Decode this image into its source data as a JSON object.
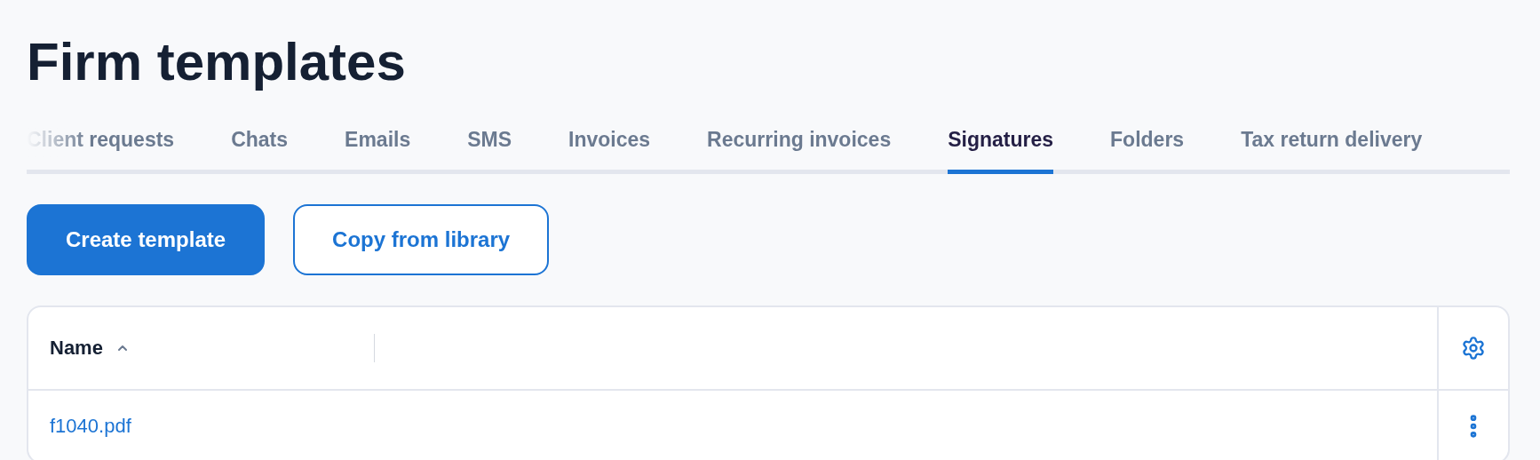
{
  "page_title": "Firm templates",
  "tabs": [
    {
      "label": "Client requests",
      "selected": false
    },
    {
      "label": "Chats",
      "selected": false
    },
    {
      "label": "Emails",
      "selected": false
    },
    {
      "label": "SMS",
      "selected": false
    },
    {
      "label": "Invoices",
      "selected": false
    },
    {
      "label": "Recurring invoices",
      "selected": false
    },
    {
      "label": "Signatures",
      "selected": true
    },
    {
      "label": "Folders",
      "selected": false
    },
    {
      "label": "Tax return delivery",
      "selected": false
    }
  ],
  "buttons": [
    {
      "label": "Create template",
      "kind": "primary"
    },
    {
      "label": "Copy from library",
      "kind": "secondary"
    }
  ],
  "table": {
    "columns": [
      {
        "label": "Name",
        "sort_ascending": true
      }
    ],
    "rows": [
      {
        "name": "f1040.pdf"
      }
    ]
  }
}
